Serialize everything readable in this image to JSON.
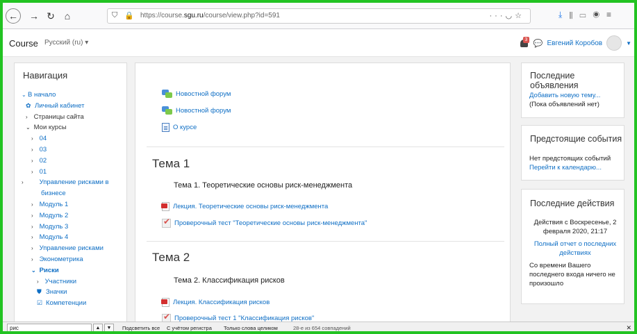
{
  "browser": {
    "url_prefix": "https://course.",
    "url_domain": "sgu.ru",
    "url_path": "/course/view.php?id=591"
  },
  "header": {
    "site_name": "Course",
    "language": "Русский (ru)",
    "notification_count": "3",
    "user_name": "Евгений Коробов"
  },
  "navigation": {
    "title": "Навигация",
    "items": [
      {
        "label": "В начало"
      },
      {
        "label": "Личный кабинет"
      },
      {
        "label": "Страницы сайта"
      },
      {
        "label": "Мои курсы"
      },
      {
        "label": "04"
      },
      {
        "label": "03"
      },
      {
        "label": "02"
      },
      {
        "label": "01"
      },
      {
        "label": "Управление рисками в бизнесе"
      },
      {
        "label": "Модуль 1"
      },
      {
        "label": "Модуль 2"
      },
      {
        "label": "Модуль 3"
      },
      {
        "label": "Модуль 4"
      },
      {
        "label": "Управление рисками"
      },
      {
        "label": "Эконометрика"
      },
      {
        "label": "Риски"
      },
      {
        "label": "Участники"
      },
      {
        "label": "Значки"
      },
      {
        "label": "Компетенции"
      }
    ]
  },
  "main": {
    "top_activities": [
      {
        "label": "Новостной форум",
        "icon": "forum-icon"
      },
      {
        "label": "Новостной форум",
        "icon": "forum-icon"
      },
      {
        "label": "О курсе",
        "icon": "page-icon"
      }
    ],
    "sections": [
      {
        "title": "Тема 1",
        "summary": "Тема 1. Теоретические основы риск-менеджмента",
        "activities": [
          {
            "label": "Лекция. Теоретические основы риск-менеджмента",
            "icon": "pdf-icon"
          },
          {
            "label": "Проверочный тест \"Теоретические основы риск-менеджмента\"",
            "icon": "quiz-icon"
          }
        ]
      },
      {
        "title": "Тема 2",
        "summary": "Тема 2. Классификация рисков",
        "activities": [
          {
            "label": "Лекция. Классификация рисков",
            "icon": "pdf-icon"
          },
          {
            "label": "Проверочный тест 1 \"Классификация рисков\"",
            "icon": "quiz-icon"
          }
        ]
      }
    ]
  },
  "blocks": {
    "announcements": {
      "title": "Последние объявления",
      "add_link": "Добавить новую тему...",
      "empty": "(Пока объявлений нет)"
    },
    "events": {
      "title": "Предстоящие события",
      "empty": "Нет предстоящих событий",
      "calendar_link": "Перейти к календарю..."
    },
    "recent": {
      "title": "Последние действия",
      "since": "Действия с Воскресенье, 2 февраля 2020, 21:17",
      "report_link": "Полный отчет о последних действиях",
      "nothing": "Со времени Вашего последнего входа ничего не произошло"
    }
  },
  "findbar": {
    "query": "рис",
    "highlight_all": "Подсветить все",
    "match_case": "С учётом регистра",
    "whole_words": "Только слова целиком",
    "status": "28-е из 654 совпадений"
  },
  "colors": {
    "link": "#0f6fc5",
    "frame_border": "#22c322",
    "page_bg": "#f2f2f2"
  }
}
